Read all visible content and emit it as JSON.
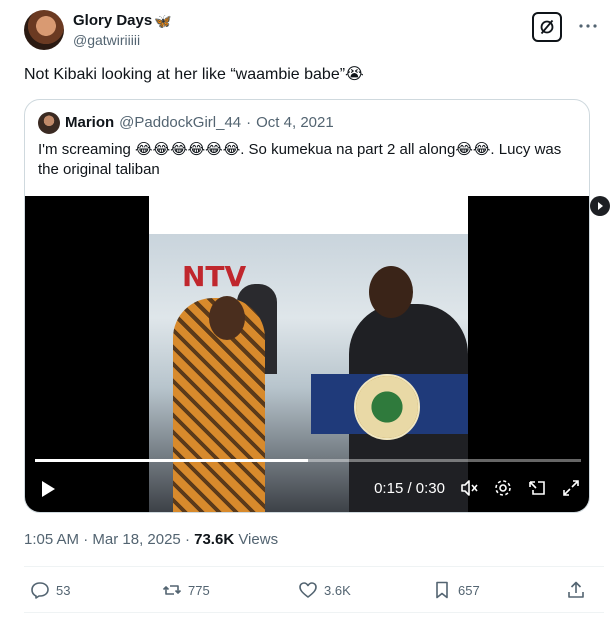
{
  "author": {
    "display_name": "Glory Days",
    "name_emoji": "🦋",
    "handle": "@gatwiriiiii"
  },
  "tweet": {
    "text": "Not Kibaki looking at her like “waambie babe”😭"
  },
  "quoted": {
    "name": "Marion",
    "handle": "@PaddockGirl_44",
    "separator": "·",
    "date": "Oct 4, 2021",
    "text": "I'm screaming 😂😂😂😂😂😂. So kumekua na part 2 all along😂😂. Lucy was the original taliban",
    "video": {
      "watermark": "NTV",
      "time_display": "0:15 / 0:30",
      "progress": 0.5
    }
  },
  "meta": {
    "time": "1:05 AM",
    "separator": "·",
    "date": "Mar 18, 2025",
    "separator2": "·",
    "views_count": "73.6K",
    "views_label": "Views"
  },
  "actions": {
    "replies": "53",
    "reposts": "775",
    "likes": "3.6K",
    "bookmarks": "657"
  },
  "icons": {
    "grok": "grok-icon",
    "more": "more-icon",
    "reply": "reply-icon",
    "repost": "repost-icon",
    "like": "like-icon",
    "bookmark": "bookmark-icon",
    "share": "share-icon"
  },
  "colors": {
    "text_primary": "#0f1419",
    "text_secondary": "#536471",
    "border": "#cfd9de"
  }
}
